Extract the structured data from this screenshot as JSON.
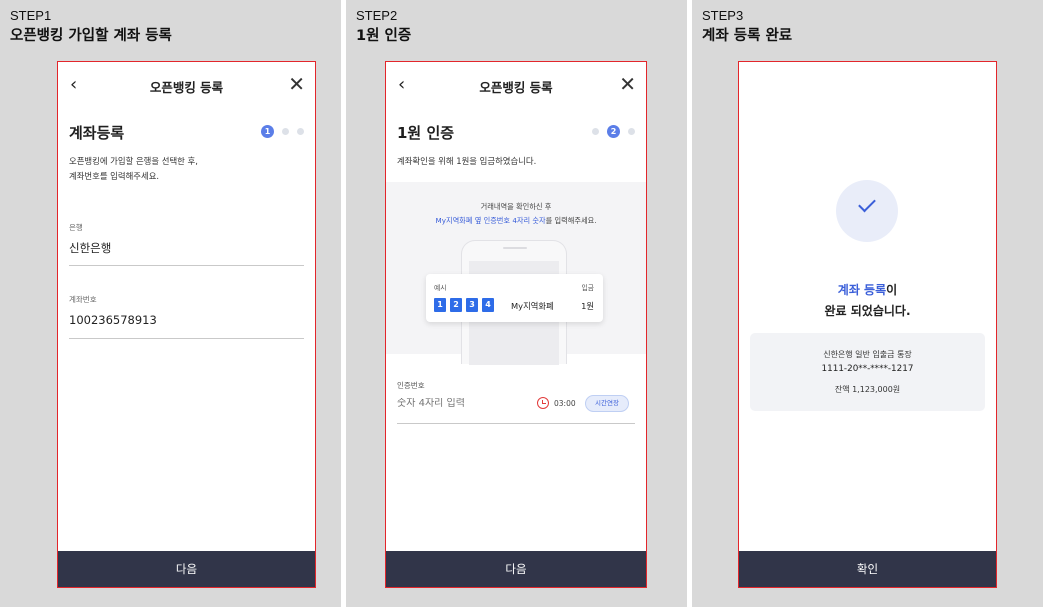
{
  "steps": [
    {
      "step_label": "STEP1",
      "step_title": "오픈뱅킹 가입할 계좌 등록",
      "header": {
        "back_icon": "chevron-left-icon",
        "title": "오픈뱅킹 등록",
        "close_icon": "close-icon"
      },
      "page_title": "계좌등록",
      "progress": {
        "current": 1,
        "total": 3,
        "current_label": "1"
      },
      "description": "오픈뱅킹에 가입할 은행을 선택한 후,\n계좌번호를 입력해주세요.",
      "bank_field": {
        "label": "은행",
        "value": "신한은행"
      },
      "account_field": {
        "label": "계좌번호",
        "value": "100236578913"
      },
      "next_button": "다음"
    },
    {
      "step_label": "STEP2",
      "step_title": "1원 인증",
      "header": {
        "back_icon": "chevron-left-icon",
        "title": "오픈뱅킹 등록",
        "close_icon": "close-icon"
      },
      "page_title": "1원 인증",
      "progress": {
        "current": 2,
        "total": 3,
        "current_label": "2"
      },
      "description": "계좌확인을 위해 1원을 입금하였습니다.",
      "guide_line1": "거래내역을 확인하신 후",
      "guide_line2_highlight": "My지역화폐 옆 인증번호 4자리 숫자",
      "guide_line2_rest": "를 입력해주세요.",
      "example": {
        "label": "예시",
        "amount_label": "입금",
        "digits": [
          "1",
          "2",
          "3",
          "4"
        ],
        "name": "My지역화폐",
        "amount": "1원"
      },
      "auth_label": "인증번호",
      "auth_placeholder": "숫자 4자리 입력",
      "timer_icon": "clock-icon",
      "timer": "03:00",
      "extend_button": "시간연장",
      "next_button": "다음"
    },
    {
      "step_label": "STEP3",
      "step_title": "계좌 등록 완료",
      "check_icon": "check-icon",
      "done_highlight": "계좌 등록",
      "done_suffix": "이",
      "done_line2": "완료 되었습니다.",
      "account": {
        "name": "신한은행 일반 입출금 통장",
        "number": "1111-20**-****-1217",
        "balance": "잔액 1,123,000원"
      },
      "confirm_button": "확인"
    }
  ],
  "colors": {
    "accent": "#3b5fd9",
    "button_bg": "#313549",
    "frame_border": "#e3262b",
    "panel_bg": "#d9d9d9"
  }
}
